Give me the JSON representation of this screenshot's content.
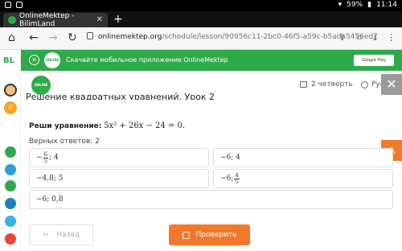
{
  "status": {
    "battery": "59%",
    "time": "11:14"
  },
  "browser": {
    "tab_title": "OnlineMektep - BilimLand",
    "url_host": "onlinemektep.org",
    "url_path": "/schedule/lesson/90956c11-2bc0-46f5-a59c-b5ada5456ed7"
  },
  "sidebar": {
    "logo": "BL",
    "badge": "0"
  },
  "banner": {
    "text": "Скачайте мобильное приложение OnlineMektep",
    "logo_text": "ONLINE MEKTEP",
    "store_label": "Google Play"
  },
  "header": {
    "logo_text": "ONLINE MEKTEP",
    "lesson_title": "Решение квадратных уравнений. Урок 2",
    "quarter": "2 четверть",
    "language": "Русс"
  },
  "question": {
    "label": "Реши уравнение:",
    "equation": "5x² + 26x − 24 = 0.",
    "correct_answers": "Верных ответов: 2"
  },
  "options": {
    "o1_prefix": "−",
    "o1_num": "6",
    "o1_den": "5",
    "o1_suffix": "; 4",
    "o2": "−6; 4",
    "o3": "−4,8; 5",
    "o4_prefix": "−6;",
    "o4_num": "4",
    "o4_den": "5",
    "o5": "−6; 0,8"
  },
  "buttons": {
    "back": "Назад",
    "check": "Проверить"
  },
  "colors": {
    "green": "#2eaa4a",
    "orange": "#f2792b"
  }
}
